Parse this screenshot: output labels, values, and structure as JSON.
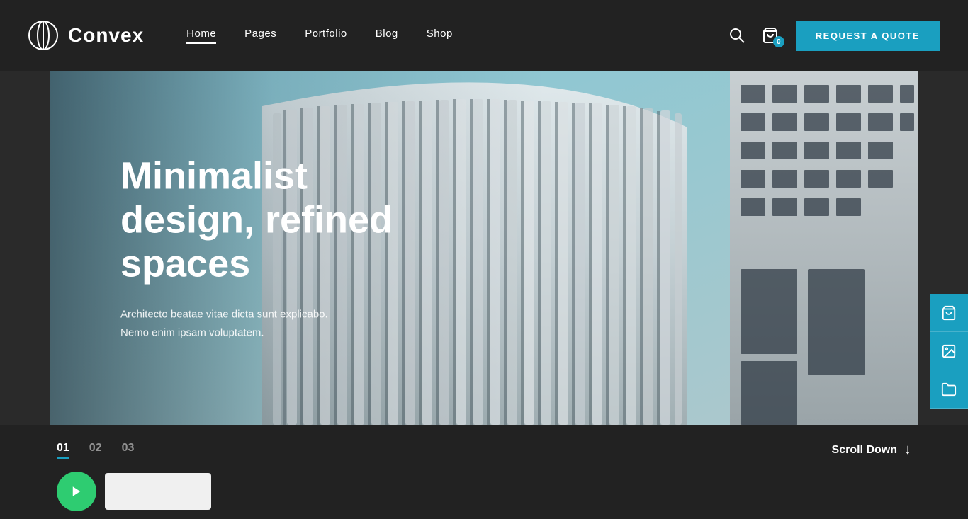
{
  "header": {
    "logo_text": "Convex",
    "nav_items": [
      {
        "label": "Home",
        "active": true
      },
      {
        "label": "Pages",
        "active": false
      },
      {
        "label": "Portfolio",
        "active": false
      },
      {
        "label": "Blog",
        "active": false
      },
      {
        "label": "Shop",
        "active": false
      }
    ],
    "cta_label": "REQUEST A QUOTE",
    "cart_count": "0"
  },
  "hero": {
    "title": "Minimalist design, refined spaces",
    "subtitle_line1": "Architecto beatae vitae dicta sunt explicabo.",
    "subtitle_line2": "Nemo enim ipsam voluptatem.",
    "accent_color": "#1a9fc0"
  },
  "side_icons": [
    {
      "name": "cart-side-icon",
      "symbol": "🛒"
    },
    {
      "name": "image-side-icon",
      "symbol": "🖼"
    },
    {
      "name": "folder-side-icon",
      "symbol": "📁"
    }
  ],
  "bottom_bar": {
    "slides": [
      {
        "num": "01",
        "active": true
      },
      {
        "num": "02",
        "active": false
      },
      {
        "num": "03",
        "active": false
      }
    ],
    "scroll_down_label": "Scroll Down"
  }
}
